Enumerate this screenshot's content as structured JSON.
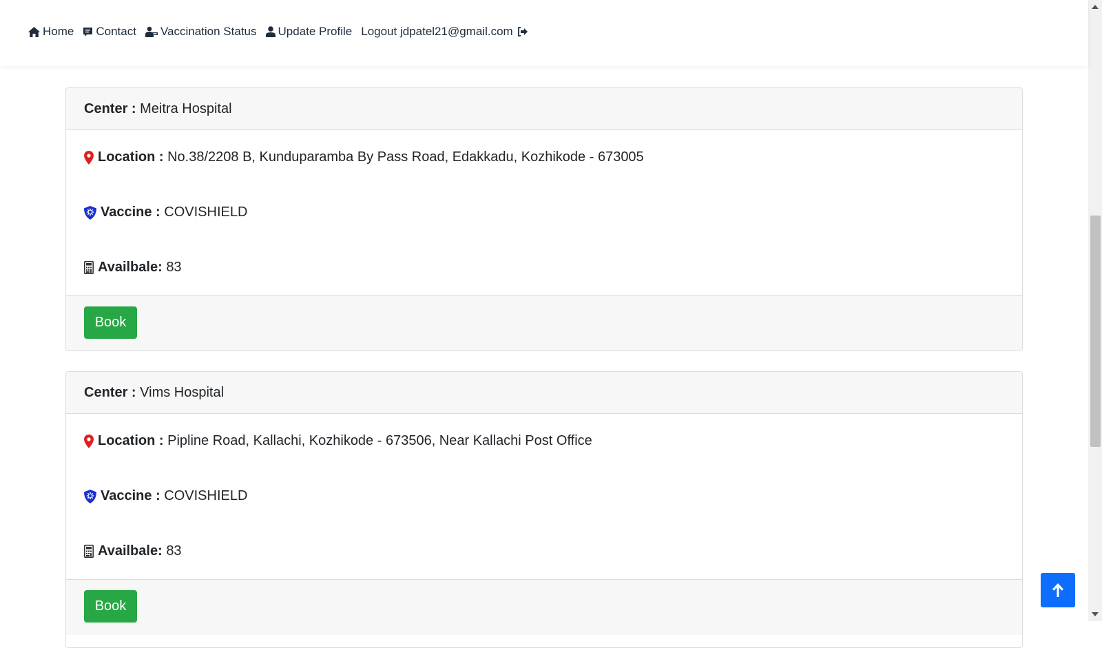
{
  "nav": {
    "home": "Home",
    "contact": "Contact",
    "vaccination_status": "Vaccination Status",
    "update_profile": "Update Profile",
    "logout": "Logout jdpatel21@gmail.com"
  },
  "labels": {
    "center": "Center :",
    "location": "Location :",
    "vaccine": "Vaccine :",
    "available": "Availbale:",
    "book": "Book"
  },
  "centers": [
    {
      "name": "Meitra Hospital",
      "location": "No.38/2208 B, Kunduparamba By Pass Road, Edakkadu, Kozhikode - 673005",
      "vaccine": "COVISHIELD",
      "available": "83"
    },
    {
      "name": "Vims Hospital",
      "location": "Pipline Road, Kallachi, Kozhikode - 673506, Near Kallachi Post Office",
      "vaccine": "COVISHIELD",
      "available": "83"
    }
  ],
  "colors": {
    "book_button": "#28a745",
    "back_to_top": "#0d6efd",
    "location_icon": "#e02020",
    "vaccine_icon": "#1a2fd0"
  },
  "icons": {
    "home": "home-icon",
    "contact": "comment-icon",
    "vaccination_status": "user-injection-icon",
    "update_profile": "user-icon",
    "logout": "sign-out-icon",
    "location": "map-pin-icon",
    "vaccine": "shield-virus-icon",
    "available": "calculator-icon",
    "back_to_top": "arrow-up-icon"
  }
}
